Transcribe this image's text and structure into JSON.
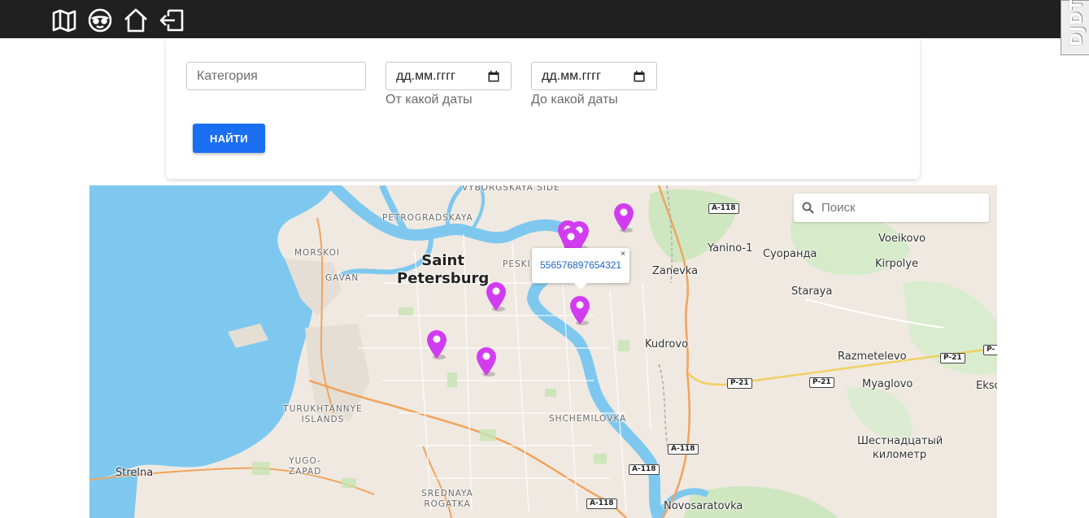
{
  "topbar": {
    "icons": [
      "map-icon",
      "driver-icon",
      "home-icon",
      "logout-icon"
    ],
    "debug_toolbar_label": "DJDT"
  },
  "filters": {
    "category_placeholder": "Категория",
    "date_from_placeholder": "дд.мм.гггг",
    "date_from_helper": "От какой даты",
    "date_to_placeholder": "дд.мм.гггг",
    "date_to_helper": "До какой даты",
    "search_button": "НАЙТИ",
    "button_color": "#1a6ff0"
  },
  "map": {
    "search_placeholder": "Поиск",
    "popup_link": "556576897654321",
    "popup_close": "×",
    "marker_color": "#d23cf0",
    "marker_count": 8,
    "labels": {
      "city": [
        "Saint",
        "Petersburg"
      ],
      "districts": [
        "VYBORGSKAYA SIDE",
        "PETROGRADSKAYA",
        "MORSKOI",
        "GAVAN",
        "PESKI",
        "TURUKHTANNYE ISLANDS",
        "YUGO-ZAPAD",
        "SREDNAYA ROGATKA",
        "SHCHEMILOVKA"
      ],
      "towns": [
        "Yanino-1",
        "Voeikovo",
        "Суоранда",
        "Kirpolye",
        "Zanevka",
        "Staraya",
        "Kudrovo",
        "Razmetelevo",
        "Myaglovo",
        "Ekso",
        "Шестнадцатый километр",
        "Strelna",
        "Novosaratovka"
      ],
      "shields": [
        "A-118",
        "P-21",
        "P-21",
        "P-21",
        "A-118",
        "A-118",
        "A-118",
        "P-"
      ]
    }
  }
}
